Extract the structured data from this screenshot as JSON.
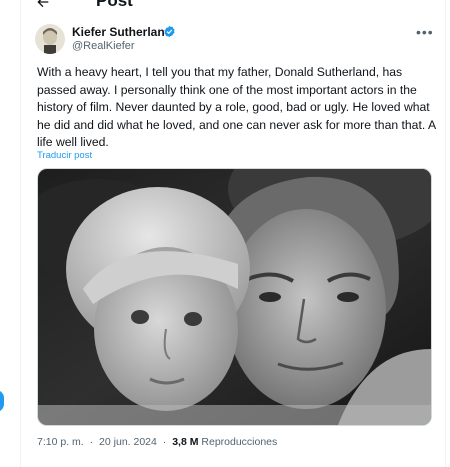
{
  "header": {
    "title": "Post"
  },
  "author": {
    "name": "Kiefer Sutherland",
    "handle": "@RealKiefer",
    "verified": true
  },
  "post": {
    "text": "With a heavy heart, I tell you that my father, Donald Sutherland, has passed away. I personally think one of the most important actors in the history of film. Never daunted by a role, good, bad or ugly. He loved what he did and did what he loved, and one can never ask for more than that. A life well lived.",
    "translate_label": "Traducir post"
  },
  "meta": {
    "time": "7:10 p. m.",
    "separator": "·",
    "date": "20 jun. 2024",
    "views_count": "3,8 M",
    "views_label": "Reproducciones"
  },
  "colors": {
    "accent": "#1d9bf0",
    "text": "#0f1419",
    "secondary": "#536471"
  },
  "icons": {
    "back": "arrow-left-icon",
    "verified": "verified-badge-icon",
    "more": "more-dots-icon"
  }
}
